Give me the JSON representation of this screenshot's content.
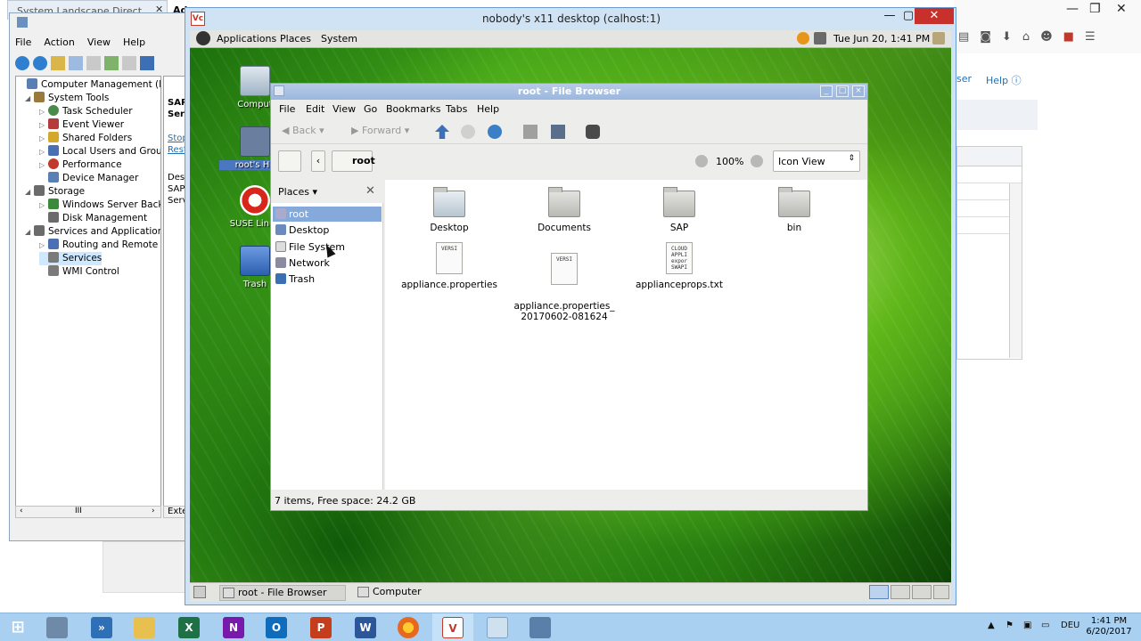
{
  "browser_tabs": {
    "tab1": "System Landscape Directory",
    "tab1_close": "✕",
    "tab2": "Ad"
  },
  "browser": {
    "help": "Help",
    "ser": "ser",
    "controls": [
      "—",
      "❐",
      "✕"
    ]
  },
  "comp_mgmt": {
    "menu": [
      "File",
      "Action",
      "View",
      "Help"
    ],
    "tree": [
      {
        "label": "Computer Management (Local",
        "level": 0,
        "tw": "",
        "color": "#5a7fb5"
      },
      {
        "label": "System Tools",
        "level": 1,
        "tw": "◢",
        "color": "#9a7a3a"
      },
      {
        "label": "Task Scheduler",
        "level": 2,
        "tw": "▷",
        "color": "#4a8a4a"
      },
      {
        "label": "Event Viewer",
        "level": 2,
        "tw": "▷",
        "color": "#b53a3a"
      },
      {
        "label": "Shared Folders",
        "level": 2,
        "tw": "▷",
        "color": "#d4a82c"
      },
      {
        "label": "Local Users and Groups",
        "level": 2,
        "tw": "▷",
        "color": "#4a6fb5"
      },
      {
        "label": "Performance",
        "level": 2,
        "tw": "▷",
        "color": "#c0392b"
      },
      {
        "label": "Device Manager",
        "level": 2,
        "tw": "",
        "color": "#5a7fb5"
      },
      {
        "label": "Storage",
        "level": 1,
        "tw": "◢",
        "color": "#6b6b6b"
      },
      {
        "label": "Windows Server Backup",
        "level": 2,
        "tw": "▷",
        "color": "#3a8a3a"
      },
      {
        "label": "Disk Management",
        "level": 2,
        "tw": "",
        "color": "#6b6b6b"
      },
      {
        "label": "Services and Applications",
        "level": 1,
        "tw": "◢",
        "color": "#6b6b6b"
      },
      {
        "label": "Routing and Remote Ac",
        "level": 2,
        "tw": "▷",
        "color": "#4a6fb5"
      },
      {
        "label": "Services",
        "level": 2,
        "tw": "",
        "color": "#7a7a7a",
        "selected": true
      },
      {
        "label": "WMI Control",
        "level": 2,
        "tw": "",
        "color": "#7a7a7a"
      }
    ],
    "right_text": [
      "SAP I",
      "Serv",
      "Stop",
      "Resta",
      "Desc",
      "SAP E",
      "Serve"
    ],
    "ext_tab": "Exte",
    "scroll_left": "‹",
    "scroll_right": "›",
    "scroll_thumb": "III"
  },
  "vnc": {
    "title": "nobody's x11 desktop (calhost:1)",
    "logo": "Vc",
    "controls": [
      "—",
      "▢",
      "✕"
    ]
  },
  "gnome_panel": {
    "menus": [
      "Applications",
      "Places",
      "System"
    ],
    "clock": "Tue Jun 20,  1:41 PM"
  },
  "desktop_icons": [
    "Comput",
    "root's Ho",
    "SUSE Linux",
    "Trash"
  ],
  "file_browser": {
    "title": "root - File Browser",
    "menu": [
      "File",
      "Edit",
      "View",
      "Go",
      "Bookmarks",
      "Tabs",
      "Help"
    ],
    "back": "Back",
    "forward": "Forward",
    "nav_left": "‹",
    "location": "root",
    "zoom": "100%",
    "view_mode": "Icon View",
    "places_label": "Places",
    "places": [
      "root",
      "Desktop",
      "File System",
      "Network",
      "Trash"
    ],
    "items": [
      {
        "name": "Desktop",
        "kind": "desktop-folder"
      },
      {
        "name": "Documents",
        "kind": "folder"
      },
      {
        "name": "SAP",
        "kind": "folder"
      },
      {
        "name": "bin",
        "kind": "folder"
      },
      {
        "name": "appliance.properties",
        "kind": "doc",
        "preview": "VERSI"
      },
      {
        "name": "appliance.properties_\n20170602-081624",
        "kind": "doc",
        "preview": "VERSI"
      },
      {
        "name": "applianceprops.txt",
        "kind": "doc",
        "preview": "CLOUD\nAPPLI\nexpor\nSWAPI"
      }
    ],
    "status": "7 items, Free space: 24.2 GB"
  },
  "gnome_bottom": {
    "tasks": [
      "root - File Browser",
      "Computer"
    ]
  },
  "taskbar": {
    "lang": "DEU",
    "time": "1:41 PM",
    "date": "6/20/2017"
  }
}
